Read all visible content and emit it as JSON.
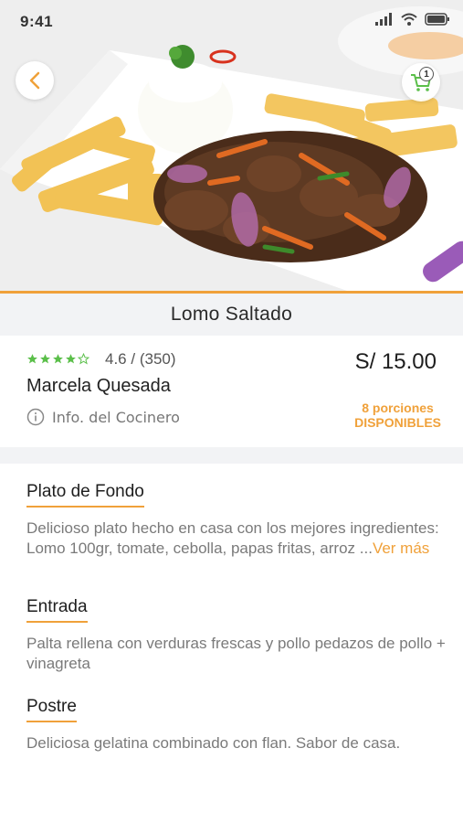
{
  "status_bar": {
    "time": "9:41"
  },
  "header": {
    "cart_count": "1"
  },
  "dish": {
    "name": "Lomo Saltado",
    "rating_stars": 4,
    "rating_value": "4.6",
    "rating_count": "(350)",
    "rating_separator": "/",
    "cook_name": "Marcela Quesada",
    "cook_info_label": "Info. del Cocinero",
    "price": "S/ 15.00",
    "portions": "8 porciones",
    "availability": "DISPONIBLES"
  },
  "sections": [
    {
      "title": "Plato de Fondo",
      "description": "Delicioso plato hecho en casa con los mejores ingredientes: Lomo 100gr, tomate, cebolla, papas fritas, arroz ...",
      "more_label": "Ver más"
    },
    {
      "title": "Entrada",
      "description": "Palta rellena con verduras frescas y pollo pedazos de pollo + vinagreta"
    },
    {
      "title": "Postre",
      "description": "Deliciosa gelatina combinado con flan. Sabor de casa."
    }
  ],
  "colors": {
    "accent": "#f0a13a",
    "star": "#5bbf4a",
    "strip": "#f2f3f5"
  },
  "icons": [
    "back-chevron-icon",
    "cart-icon",
    "info-icon",
    "star-icon",
    "signal-icon",
    "wifi-icon",
    "battery-icon"
  ]
}
